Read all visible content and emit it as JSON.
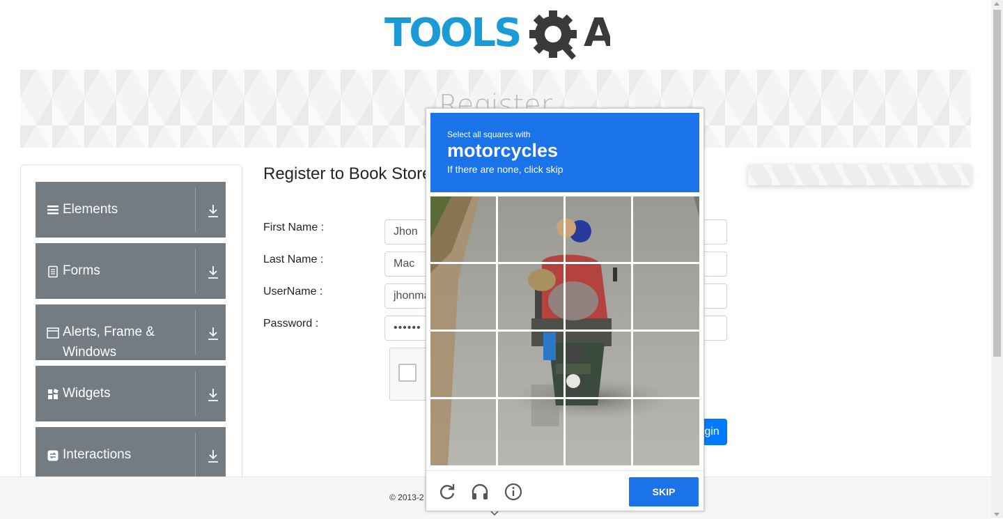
{
  "logo": {
    "part1": "TOOLS",
    "part3": "A"
  },
  "banner": {
    "title": "Register"
  },
  "sidebar": {
    "groups": [
      {
        "label": "Elements",
        "icon": "hamburger-icon"
      },
      {
        "label": "Forms",
        "icon": "document-icon"
      },
      {
        "label": "Alerts, Frame &",
        "label2": "Windows",
        "icon": "window-icon"
      },
      {
        "label": "Widgets",
        "icon": "widgets-icon"
      },
      {
        "label": "Interactions",
        "icon": "interactions-icon"
      }
    ]
  },
  "form": {
    "title": "Register to Book Store",
    "first_name": {
      "label": "First Name :",
      "value": "Jhon"
    },
    "last_name": {
      "label": "Last Name :",
      "value": "Mac"
    },
    "username": {
      "label": "UserName :",
      "value": "jhonmac"
    },
    "password": {
      "label": "Password :",
      "value": "••••••"
    },
    "login_label": "gin"
  },
  "footer": {
    "text": "© 2013-2"
  },
  "captcha": {
    "instruction": "Select all squares with",
    "target": "motorcycles",
    "hint": "If there are none, click skip",
    "skip_label": "SKIP",
    "grid": {
      "rows": 4,
      "cols": 4
    }
  },
  "colors": {
    "captcha_blue": "#1a73e8",
    "sidebar_gray": "#737b83",
    "login_blue": "#007bff",
    "logo_blue": "#1a9ad6",
    "logo_dark": "#3a3a3a"
  }
}
